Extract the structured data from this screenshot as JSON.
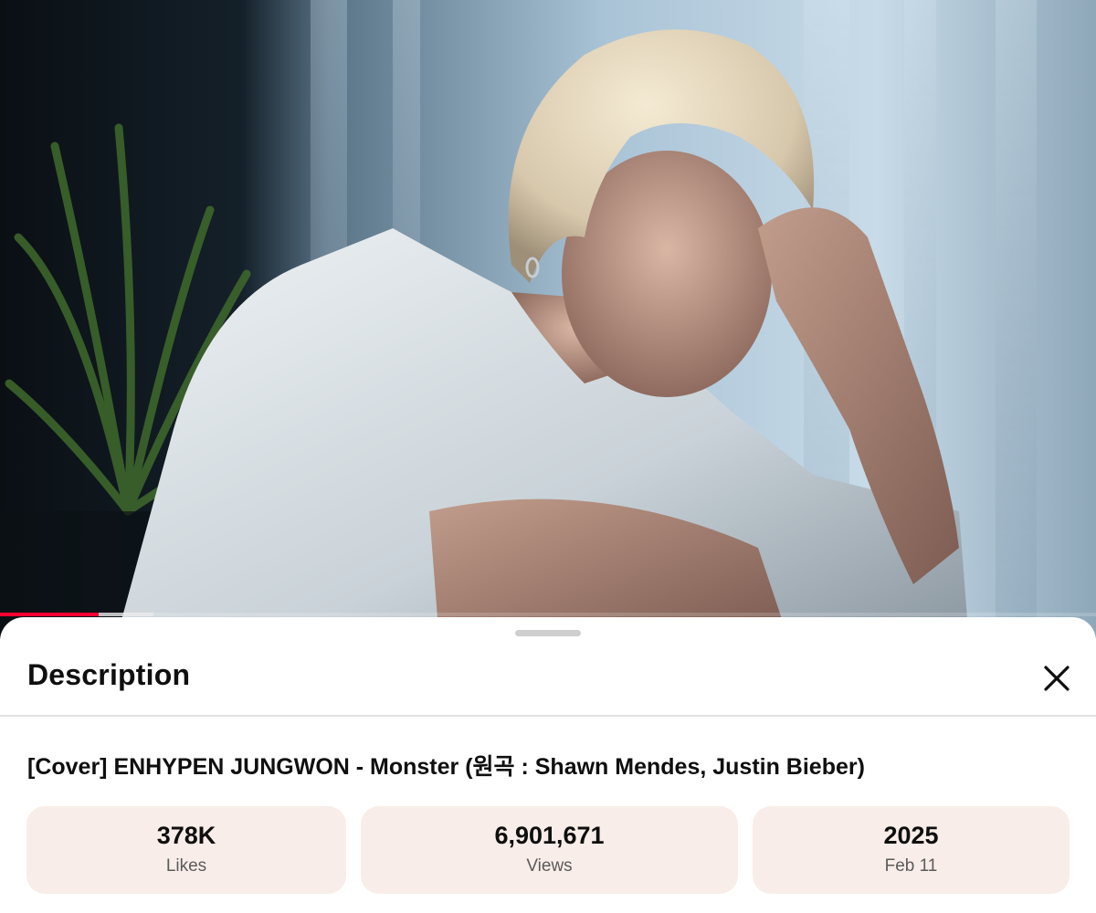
{
  "player": {
    "progress_played": 0.09,
    "progress_buffered": 0.14,
    "progress_color": "#ff0033"
  },
  "sheet": {
    "title": "Description",
    "close_icon": "close-icon"
  },
  "video": {
    "title": "[Cover] ENHYPEN JUNGWON - Monster (원곡 : Shawn Mendes, Justin Bieber)"
  },
  "stats": {
    "likes": {
      "value": "378K",
      "label": "Likes"
    },
    "views": {
      "value": "6,901,671",
      "label": "Views"
    },
    "date": {
      "value": "2025",
      "label": "Feb 11"
    }
  },
  "colors": {
    "stat_background": "#f8ede8",
    "text_primary": "#0f0f0f",
    "text_secondary": "#5b5b5b"
  }
}
